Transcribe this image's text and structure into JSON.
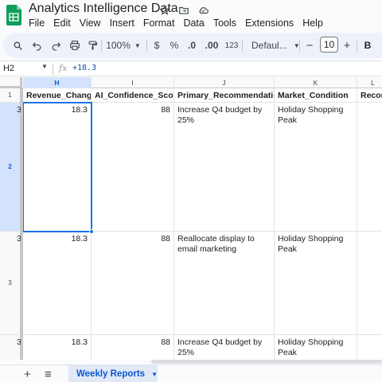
{
  "doc": {
    "title": "Analytics Intelligence Data",
    "logo_color": "#0f9d58"
  },
  "menu": [
    "File",
    "Edit",
    "View",
    "Insert",
    "Format",
    "Data",
    "Tools",
    "Extensions",
    "Help"
  ],
  "toolbar": {
    "zoom": "100%",
    "currency": "$",
    "percent": "%",
    "decrease_decimal": ".0",
    "increase_decimal": ".00",
    "number_format": "123",
    "font": "Defaul...",
    "font_size": "10",
    "bold": "B",
    "minus": "−",
    "plus": "+"
  },
  "formula_bar": {
    "cell_ref": "H2",
    "fx": "fx",
    "value": "+18.3"
  },
  "columns": [
    {
      "letter": "H",
      "selected": true
    },
    {
      "letter": "I",
      "selected": false
    },
    {
      "letter": "J",
      "selected": false
    },
    {
      "letter": "K",
      "selected": false
    },
    {
      "letter": "L",
      "selected": false
    }
  ],
  "header_row": {
    "row_number": "1",
    "g_partial": "",
    "cells": [
      "Revenue_Change",
      "AI_Confidence_Score",
      "Primary_Recommendation",
      "Market_Condition",
      "Recom"
    ]
  },
  "rows": [
    {
      "row_number": "2",
      "g_partial": "3",
      "revenue_change": "18.3",
      "ai_confidence": "88",
      "recommendation": "Increase Q4 budget by 25%",
      "market_condition": "Holiday Shopping Peak",
      "selected": true
    },
    {
      "row_number": "3",
      "g_partial": "3",
      "revenue_change": "18.3",
      "ai_confidence": "88",
      "recommendation": "Reallocate display to email marketing",
      "market_condition": "Holiday Shopping Peak",
      "selected": false
    },
    {
      "row_number": "",
      "g_partial": "3",
      "revenue_change": "18.3",
      "ai_confidence": "88",
      "recommendation": "Increase Q4 budget by 25%",
      "market_condition": "Holiday Shopping Peak",
      "selected": false
    }
  ],
  "sheet_tabs": {
    "active": "Weekly Reports",
    "add": "+",
    "all_sheets": "≡"
  },
  "colors": {
    "selection": "#1a73e8",
    "selected_header_bg": "#d3e3fd",
    "active_tab_bg": "#e1e9f7",
    "active_tab_text": "#0b57d0",
    "formula_text": "#1a4fa3"
  }
}
